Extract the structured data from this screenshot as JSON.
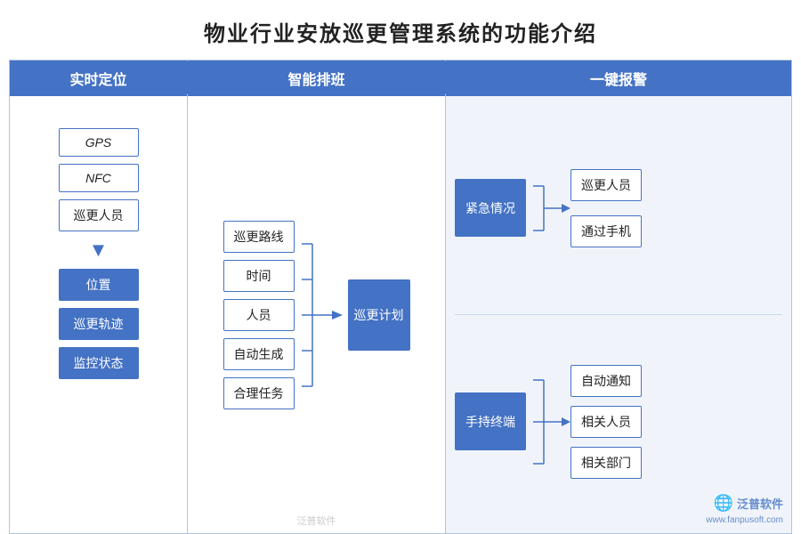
{
  "title": "物业行业安放巡更管理系统的功能介绍",
  "columns": [
    {
      "id": "col1",
      "header": "实时定位"
    },
    {
      "id": "col2",
      "header": "智能排班"
    },
    {
      "id": "col3",
      "header": "一键报警"
    }
  ],
  "left": {
    "top_items": [
      "GPS",
      "NFC",
      "巡更人员"
    ],
    "bottom_items": [
      "位置",
      "巡更轨迹",
      "监控状态"
    ]
  },
  "mid": {
    "list_items": [
      "巡更路线",
      "时间",
      "人员",
      "自动生成",
      "合理任务"
    ],
    "center_box": "巡更计划"
  },
  "right": {
    "top_box": "紧急情况",
    "top_sub": [
      "巡更人员",
      "通过手机"
    ],
    "bottom_box": "手持终端",
    "bottom_sub": [
      "自动通知",
      "相关人员",
      "相关部门"
    ]
  },
  "watermark": {
    "icon": "泛",
    "text1": "泛普软件",
    "text2": "www.fanpusoft.com"
  }
}
